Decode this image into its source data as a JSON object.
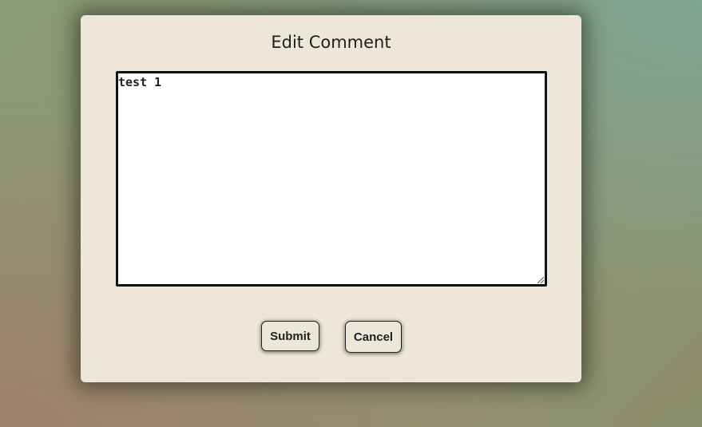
{
  "dialog": {
    "title": "Edit Comment",
    "comment_value": "test 1",
    "submit_label": "Submit",
    "cancel_label": "Cancel"
  },
  "icons": {
    "resize_grip": "resize-grip-icon"
  }
}
